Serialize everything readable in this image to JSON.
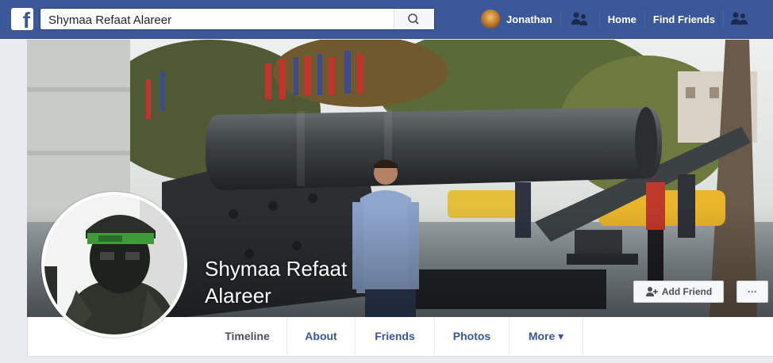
{
  "topbar": {
    "logo": "f",
    "search_value": "Shymaa Refaat Alareer",
    "search_icon": "search-icon",
    "user_name": "Jonathan",
    "home_label": "Home",
    "find_friends_label": "Find Friends"
  },
  "profile": {
    "name_line1": "Shymaa Refaat",
    "name_line2": "Alareer",
    "add_friend_label": "Add Friend",
    "more_options_label": "···"
  },
  "tabs": [
    {
      "label": "Timeline"
    },
    {
      "label": "About"
    },
    {
      "label": "Friends"
    },
    {
      "label": "Photos"
    },
    {
      "label": "More ▾"
    }
  ],
  "colors": {
    "brand": "#3b5998",
    "link": "#365899",
    "page_bg": "#e9ebee"
  }
}
